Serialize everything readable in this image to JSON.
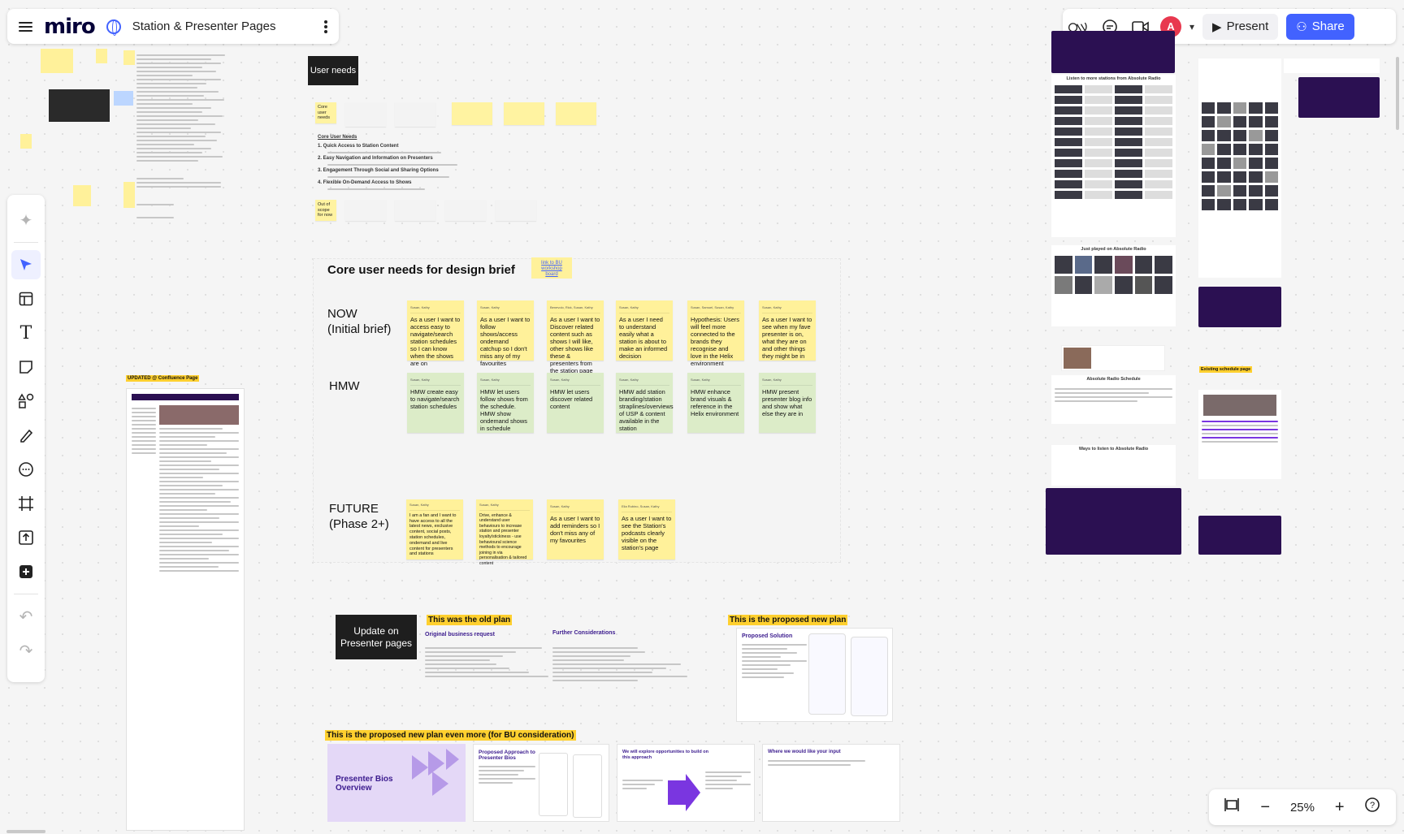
{
  "header": {
    "logo": "miro",
    "board_title": "Station & Presenter Pages"
  },
  "top_right": {
    "present_label": "Present",
    "share_label": "Share",
    "avatar_initial": "A"
  },
  "zoom": {
    "level": "25%"
  },
  "canvas": {
    "user_needs_title": "User needs",
    "core_user_needs_label": "Core user needs",
    "out_of_scope_label": "Out of scope for now",
    "core_needs_heading": "Core User Needs",
    "core_needs_list": [
      "1. Quick Access to Station Content",
      "2. Easy Navigation and Information on Presenters",
      "3. Engagement Through Social and Sharing Options",
      "4. Flexible On-Demand Access to Shows"
    ],
    "design_brief_title": "Core user needs for design brief",
    "design_brief_link": "link to BU workshop board",
    "row_now": "NOW (Initial brief)",
    "row_hmw": "HMW",
    "row_future": "FUTURE (Phase 2+)",
    "now_stickies": [
      "As a user I want to access easy to navigate/search station schedules so I can know when the shows are on",
      "As a user I want to follow shows/access ondemand catchup so I don't miss any of my favourites",
      "As a user I want to Discover related content such as shows I will like, other shows like these & presenters from the station page starting point",
      "As a user I need to understand easily what a station is about to make an informed decision",
      "Hypothesis: Users will feel more connected to the brands they recognise and love in the Helix environment",
      "As a user I want to see when my fave presenter is on, what they are on and other things they might be in"
    ],
    "hmw_stickies": [
      "HMW create easy to navigate/search station schedules",
      "HMW let users follow shows from the schedule. HMW show ondemand shows in schedule",
      "HMW let users discover related content",
      "HMW add station branding/station straplines/overviews of USP & content available in the station",
      "HMW enhance brand visuals & reference in the Helix environment",
      "HMW present presenter blog info and show what else they are in"
    ],
    "future_stickies": [
      "I am a fan and I want to have access to all the latest news, exclusive content, social posts, station schedules, ondemand and live content for presenters and stations",
      "Drive, enhance & understand user behaviours to increase station and presenter loyalty/stickiness - use behavioural science methods to encourage joining in via personalisation & tailored content",
      "As a user I want to add reminders so I don't miss any of my favourites",
      "As a user I want to see the Station's podcasts clearly visible on the station's page"
    ],
    "update_presenter": "Update on Presenter pages",
    "old_plan": "This was the old plan",
    "original_request": "Original business request",
    "further_considerations": "Further Considerations",
    "new_plan": "This is the proposed new plan",
    "proposed_solution": "Proposed Solution",
    "new_plan_more": "This is the proposed new plan even more (for BU consideration)",
    "presenter_bios": "Presenter Bios Overview",
    "proposed_approach": "Proposed Approach to Presenter Bios",
    "explore_opportunities": "We will explore opportunities to build on this approach",
    "where_input": "Where we would like your input",
    "updated_confluence": "UPDATED @ Confluence Page",
    "listen_more": "Listen to more stations from Absolute Radio",
    "just_played": "Just played on Absolute Radio",
    "schedule_title": "Absolute Radio Schedule",
    "ways_listen": "Ways to listen to Absolute Radio",
    "existing_schedule": "Existing schedule page"
  },
  "colors": {
    "accent": "#4262ff",
    "sticky_yellow": "#fff19a",
    "sticky_green": "#dcecc8",
    "highlight": "#ffd02f",
    "brand_purple": "#2b1052"
  },
  "icons": {
    "toolbar": [
      "sparkle-icon",
      "cursor-icon",
      "template-icon",
      "text-icon",
      "sticky-note-icon",
      "shapes-icon",
      "pen-icon",
      "comment-icon",
      "frame-icon",
      "upload-icon",
      "plus-icon",
      "undo-icon",
      "redo-icon"
    ]
  }
}
